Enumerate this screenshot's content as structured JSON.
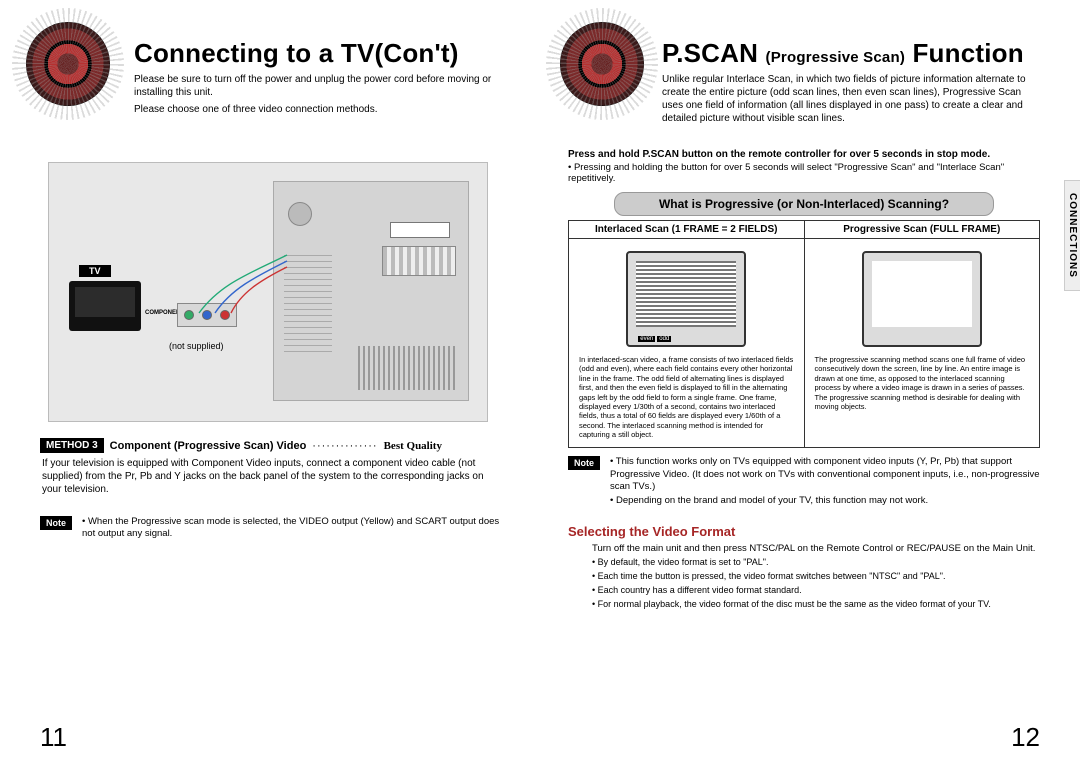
{
  "left": {
    "title": "Connecting to a TV(Con't)",
    "intro1": "Please be sure to turn off the power and unplug the power cord before moving or installing this unit.",
    "intro2": "Please choose one of three video connection methods.",
    "diagram": {
      "tv": "TV",
      "component": "COMPONENT",
      "notSupplied": "(not supplied)"
    },
    "method": {
      "badge": "METHOD 3",
      "title": "Component (Progressive Scan) Video",
      "dots": "··············",
      "quality": "Best Quality",
      "desc": "If your television is equipped with Component Video inputs, connect a component video cable (not supplied) from the Pr, Pb and Y jacks on the back panel of the system to the corresponding jacks on your television."
    },
    "noteBadge": "Note",
    "note1": "When the Progressive scan mode is selected, the VIDEO output (Yellow) and SCART output does not output any signal.",
    "pageNum": "11"
  },
  "right": {
    "titleBig": "P.SCAN",
    "titleSub": "(Progressive Scan)",
    "titleBig2": "Function",
    "intro": "Unlike regular Interlace Scan, in which two fields of picture information alternate to create the entire picture (odd scan lines, then even scan lines), Progressive Scan uses one field of information (all lines displayed in one pass) to create a clear and detailed picture without visible scan lines.",
    "instr": "Press and hold P.SCAN button on the remote controller for over 5 seconds in stop mode.",
    "instrBullet": "Pressing and holding the button for over 5 seconds will select \"Progressive Scan\" and \"Interlace Scan\" repetitively.",
    "boxhdr": "What is Progressive (or Non-Interlaced) Scanning?",
    "col1hdr": "Interlaced Scan (1 FRAME = 2 FIELDS)",
    "col2hdr": "Progressive Scan (FULL FRAME)",
    "even": "even",
    "odd": "odd",
    "col1txt": "In interlaced-scan video, a frame consists of two interlaced fields (odd and even), where each field contains every other horizontal line in the frame. The odd field of alternating lines is displayed first, and then the even field is displayed to fill in the alternating gaps left by the odd field to form a single frame. One frame, displayed every 1/30th of a second, contains two interlaced fields, thus a total of 60 fields are displayed every 1/60th of a second. The interlaced scanning method is intended for capturing a still object.",
    "col2txt": "The progressive scanning method scans one full frame of video consecutively down the screen, line by line. An entire image is drawn at one time, as opposed to the interlaced scanning process by where a video image is drawn in a series of passes. The progressive scanning method is desirable for dealing with moving objects.",
    "noteBadge": "Note",
    "noteb1": "This function works only on TVs equipped with component video inputs (Y, Pr, Pb) that support Progressive Video. (It does not work on TVs with conventional component inputs, i.e., non-progressive scan TVs.)",
    "noteb2": "Depending on the brand and model of your TV, this function may not work.",
    "sechd": "Selecting the Video Format",
    "vfmt": "Turn off the main unit and then press NTSC/PAL on the Remote Control or REC/PAUSE on the Main Unit.",
    "vf1": "By default, the video format is set to \"PAL\".",
    "vf2": "Each time the button is pressed, the video format switches between \"NTSC\" and \"PAL\".",
    "vf3": "Each country has a different video format standard.",
    "vf4": "For normal playback, the video format of the disc must be the same as the video format of your TV.",
    "sidetab": "CONNECTIONS",
    "pageNum": "12"
  }
}
